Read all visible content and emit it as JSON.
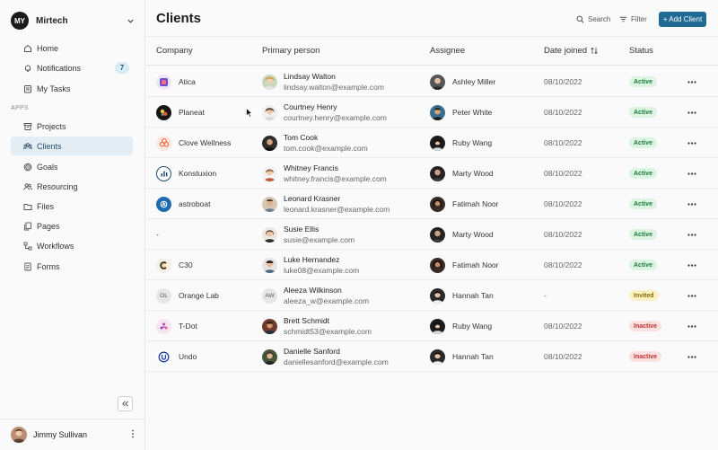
{
  "workspace": {
    "logo_text": "MY",
    "name": "Mirtech"
  },
  "nav": {
    "top": [
      {
        "label": "Home",
        "icon": "home-icon"
      },
      {
        "label": "Notifications",
        "icon": "bell-icon",
        "badge": "7"
      },
      {
        "label": "My Tasks",
        "icon": "checklist-icon"
      }
    ],
    "section_label": "APPS",
    "apps": [
      {
        "label": "Projects",
        "icon": "archive-icon"
      },
      {
        "label": "Clients",
        "icon": "users-icon",
        "active": true
      },
      {
        "label": "Goals",
        "icon": "target-icon"
      },
      {
        "label": "Resourcing",
        "icon": "user-group-icon"
      },
      {
        "label": "Files",
        "icon": "folder-icon"
      },
      {
        "label": "Pages",
        "icon": "pages-icon"
      },
      {
        "label": "Workflows",
        "icon": "workflow-icon"
      },
      {
        "label": "Forms",
        "icon": "form-icon"
      }
    ]
  },
  "user": {
    "name": "Jimmy Sullivan"
  },
  "page": {
    "title": "Clients",
    "search_label": "Search",
    "filter_label": "Filter",
    "add_label": "+ Add Client"
  },
  "table": {
    "columns": {
      "company": "Company",
      "primary": "Primary person",
      "assignee": "Assignee",
      "date": "Date joined",
      "status": "Status"
    },
    "rows": [
      {
        "company": "Atica",
        "person": "Lindsay Walton",
        "email": "lindsay.walton@example.com",
        "assignee": "Ashley Miller",
        "date": "08/10/2022",
        "status": "Active"
      },
      {
        "company": "Planeat",
        "person": "Courtney Henry",
        "email": "courtney.henry@example.com",
        "assignee": "Peter White",
        "date": "08/10/2022",
        "status": "Active"
      },
      {
        "company": "Clove Wellness",
        "person": "Tom Cook",
        "email": "tom.cook@example.com",
        "assignee": "Ruby Wang",
        "date": "08/10/2022",
        "status": "Active"
      },
      {
        "company": "Konstuxion",
        "person": "Whitney Francis",
        "email": "whitney.francis@example.com",
        "assignee": "Marty Wood",
        "date": "08/10/2022",
        "status": "Active"
      },
      {
        "company": "astroboat",
        "person": "Leonard Krasner",
        "email": "leonard.krasner@example.com",
        "assignee": "Fatimah Noor",
        "date": "08/10/2022",
        "status": "Active"
      },
      {
        "company": "-",
        "person": "Susie Ellis",
        "email": "susie@example.com",
        "assignee": "Marty Wood",
        "date": "08/10/2022",
        "status": "Active"
      },
      {
        "company": "C30",
        "person": "Luke Hernandez",
        "email": "luke08@example.com",
        "assignee": "Fatimah Noor",
        "date": "08/10/2022",
        "status": "Active"
      },
      {
        "company": "Orange Lab",
        "company_initials": "OL",
        "person": "Aleeza Wilkinson",
        "person_initials": "AW",
        "email": "aleeza_w@example.com",
        "assignee": "Hannah Tan",
        "date": "-",
        "status": "Invited"
      },
      {
        "company": "T-Dot",
        "person": "Brett Schmidt",
        "email": "schmidt53@example.com",
        "assignee": "Ruby Wang",
        "date": "08/10/2022",
        "status": "Inactive"
      },
      {
        "company": "Undo",
        "person": "Danielle Sanford",
        "email": "daniellesanford@example.com",
        "assignee": "Hannah Tan",
        "date": "08/10/2022",
        "status": "Inactive"
      }
    ]
  }
}
